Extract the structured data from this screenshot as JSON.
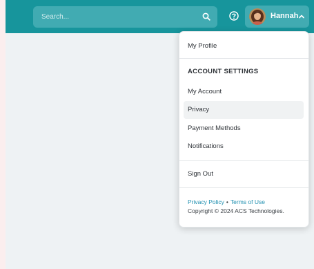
{
  "header": {
    "search": {
      "placeholder": "Search..."
    },
    "user": {
      "name": "Hannah"
    }
  },
  "menu": {
    "my_profile": "My Profile",
    "account_settings_heading": "ACCOUNT SETTINGS",
    "items": [
      "My Account",
      "Privacy",
      "Payment Methods",
      "Notifications"
    ],
    "sign_out": "Sign Out",
    "footer": {
      "privacy_policy": "Privacy Policy",
      "separator": "•",
      "terms_of_use": "Terms of Use",
      "copyright": "Copyright © 2024 ACS Technologies."
    }
  },
  "colors": {
    "topbar": "#17959c",
    "link": "#1f8fb0"
  },
  "icons": [
    "search-icon",
    "help-icon",
    "chevron-up-icon"
  ]
}
